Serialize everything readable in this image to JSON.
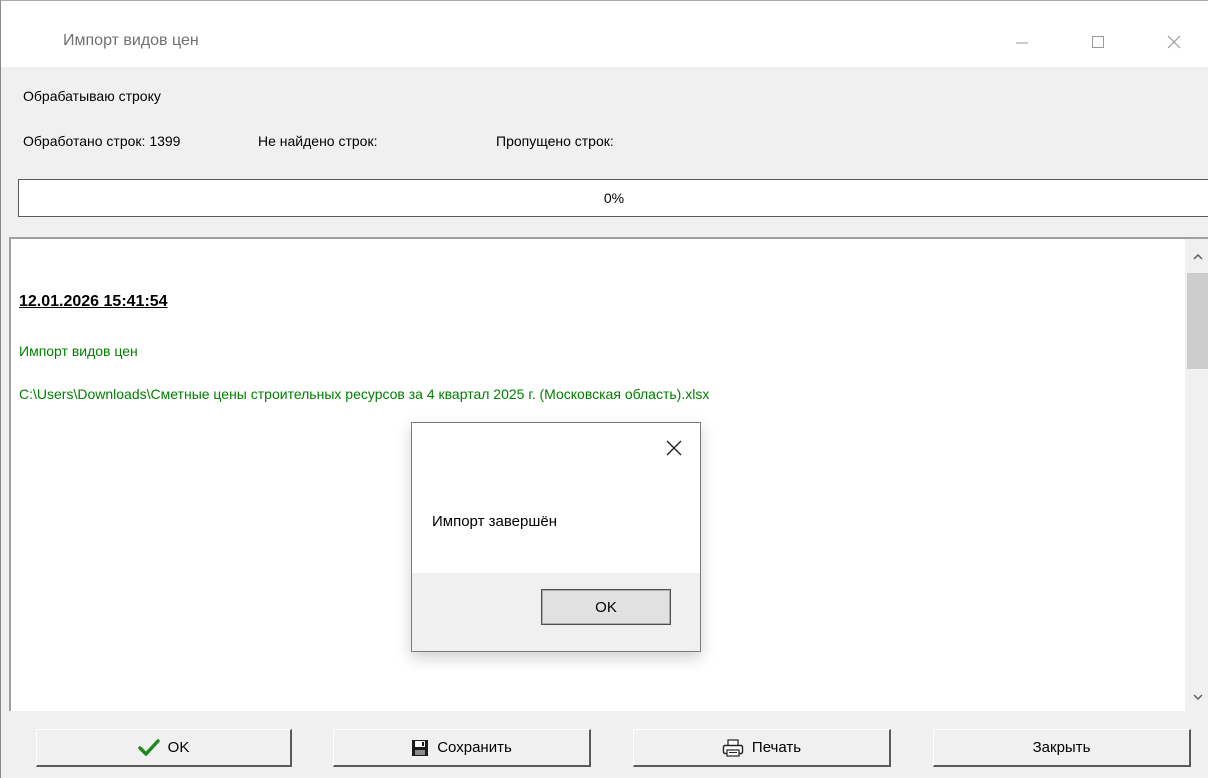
{
  "window": {
    "title": "Импорт видов цен"
  },
  "status": {
    "processing_label": "Обрабатываю строку",
    "processed_label": "Обработано строк: 1399",
    "not_found_label": "Не найдено строк:",
    "skipped_label": "Пропущено строк:"
  },
  "progress": {
    "percent": 0,
    "label": "0%",
    "fill_color": "#2c8ff0"
  },
  "log": {
    "timestamp": "12.01.2026   15:41:54",
    "lines": [
      "Импорт видов цен",
      "C:\\Users\\Downloads\\Сметные цены строительных ресурсов за 4 квартал 2025 г. (Московская область).xlsx"
    ],
    "text_color": "#008000"
  },
  "dialog": {
    "message": "Импорт завершён",
    "ok_label": "OK"
  },
  "buttons": {
    "ok_label": "OK",
    "save_label": "Сохранить",
    "print_label": "Печать",
    "close_label": "Закрыть"
  },
  "icons": {
    "ok": "checkmark-icon",
    "save": "floppy-disk-icon",
    "print": "printer-icon"
  }
}
